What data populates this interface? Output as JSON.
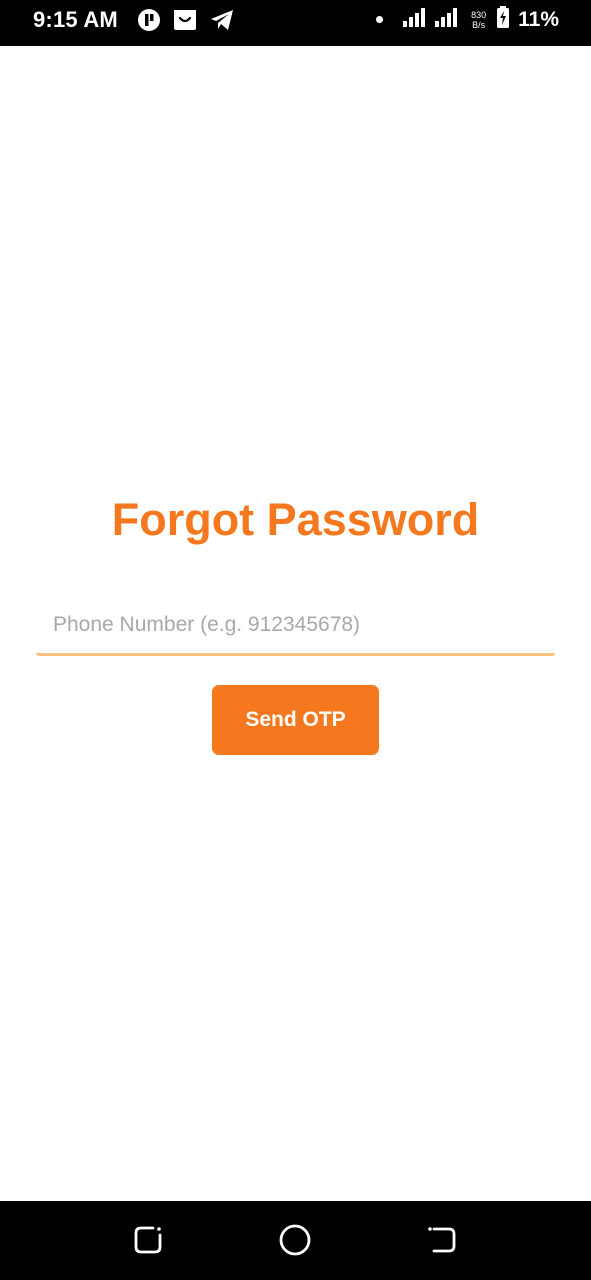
{
  "status_bar": {
    "time": "9:15 AM",
    "net_speed_value": "830",
    "net_speed_unit": "B/s",
    "battery_percent": "11%",
    "left_icons": [
      "app-notification-icon",
      "shopping-bag-icon",
      "telegram-icon"
    ],
    "right_icons": [
      "notification-dot-icon",
      "signal-icon",
      "signal-icon",
      "battery-charging-icon"
    ]
  },
  "main": {
    "title": "Forgot Password",
    "phone_input": {
      "placeholder": "Phone Number (e.g. 912345678)",
      "value": ""
    },
    "send_button_label": "Send OTP"
  },
  "nav_bar": {
    "buttons": [
      "recent-apps-icon",
      "home-icon",
      "back-icon"
    ]
  },
  "colors": {
    "accent": "#f5781e",
    "input_underline": "#f7c27d",
    "placeholder": "#a9a9a9",
    "bars": "#000000",
    "background": "#ffffff"
  }
}
